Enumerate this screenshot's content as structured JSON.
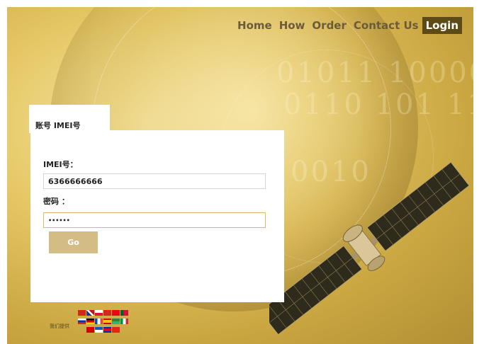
{
  "nav": {
    "items": [
      "Home",
      "How",
      "Order",
      "Contact Us"
    ],
    "login": "Login"
  },
  "panel": {
    "tab_label": "账号 IMEI号",
    "imei_label": "IMEI号：",
    "imei_value": "6366666666",
    "password_label": "密码 ：",
    "password_value": "••••••",
    "go_label": "Go"
  },
  "footer": {
    "provided_by": "我们提供"
  },
  "colors": {
    "nav_active_bg": "#5e4a14",
    "go_button": "#d4bd85",
    "background_gold": "#e6c867"
  }
}
